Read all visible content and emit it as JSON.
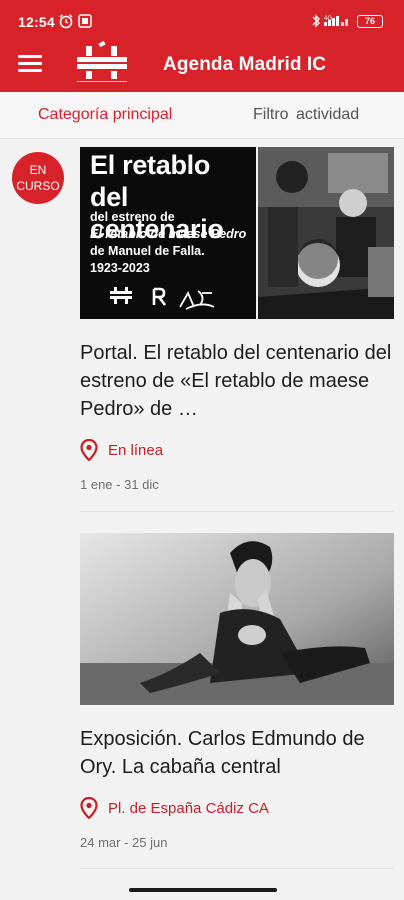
{
  "status_bar": {
    "time": "12:54",
    "battery": "76"
  },
  "app_bar": {
    "title": "Agenda Madrid IC",
    "menu_icon": "menu-icon",
    "logo_icon": "instituto-cervantes-logo"
  },
  "tabs": [
    {
      "label": "Categoría principal",
      "active": true
    },
    {
      "label": "Filtro  actividad",
      "active": false
    }
  ],
  "badge": {
    "line1": "EN",
    "line2": "CURSO"
  },
  "events": [
    {
      "poster": {
        "title_line1": "El retablo",
        "title_line2": "del centenario",
        "sub_line1": "del estreno de",
        "sub_line2": "El retablo de maese Pedro",
        "sub_line3": "de Manuel de Falla.",
        "sub_line4": "1923-2023"
      },
      "title": "Portal. El retablo del centenario del estreno de «El retablo de maese Pedro» de …",
      "location": "En línea",
      "date": "1 ene - 31 dic"
    },
    {
      "title": "Exposición. Carlos Edmundo de Ory. La cabaña central",
      "location": "Pl. de España Cádiz CA",
      "date": "24 mar - 25 jun"
    }
  ],
  "colors": {
    "brand_red": "#d8222a",
    "location_red": "#c71f26"
  }
}
